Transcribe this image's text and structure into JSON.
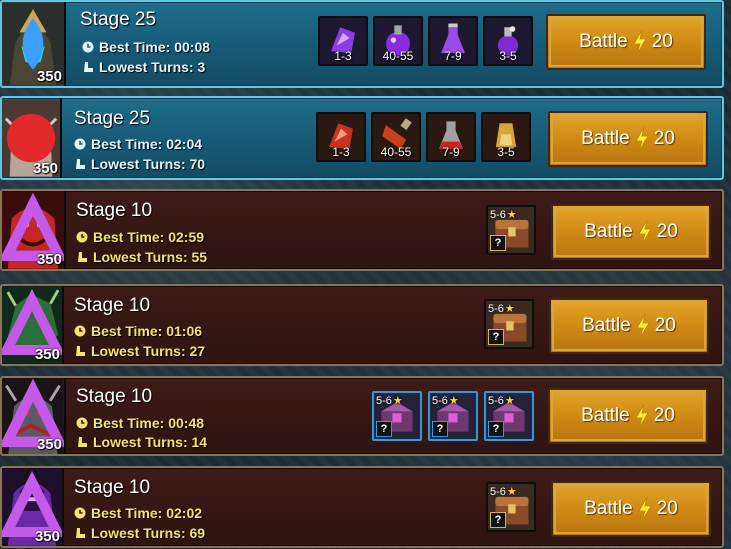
{
  "battle_label": "Battle",
  "energy_cost": "20",
  "rows": [
    {
      "stage": "Stage 25",
      "best_time_label": "Best Time: 00:08",
      "lowest_turns_label": "Lowest Turns: 3",
      "level": "350",
      "rewards": [
        {
          "range": "1-3",
          "icon": "purple-shard-icon"
        },
        {
          "range": "40-55",
          "icon": "purple-potion-icon"
        },
        {
          "range": "7-9",
          "icon": "purple-flask-icon"
        },
        {
          "range": "3-5",
          "icon": "purple-vial-icon"
        }
      ]
    },
    {
      "stage": "Stage 25",
      "best_time_label": "Best Time: 02:04",
      "lowest_turns_label": "Lowest Turns: 70",
      "level": "350",
      "rewards": [
        {
          "range": "1-3",
          "icon": "red-shard-icon"
        },
        {
          "range": "40-55",
          "icon": "red-potion-icon"
        },
        {
          "range": "7-9",
          "icon": "red-flask-icon"
        },
        {
          "range": "3-5",
          "icon": "gold-vial-icon"
        }
      ]
    },
    {
      "stage": "Stage 10",
      "best_time_label": "Best Time: 02:59",
      "lowest_turns_label": "Lowest Turns: 55",
      "level": "350",
      "chests": [
        {
          "stars": "5-6",
          "q": "?"
        }
      ]
    },
    {
      "stage": "Stage 10",
      "best_time_label": "Best Time: 01:06",
      "lowest_turns_label": "Lowest Turns: 27",
      "level": "350",
      "chests": [
        {
          "stars": "5-6",
          "q": "?"
        }
      ]
    },
    {
      "stage": "Stage 10",
      "best_time_label": "Best Time: 00:48",
      "lowest_turns_label": "Lowest Turns: 14",
      "level": "350",
      "chests": [
        {
          "stars": "5-6",
          "q": "?"
        },
        {
          "stars": "5-6",
          "q": "?"
        },
        {
          "stars": "5-6",
          "q": "?"
        }
      ]
    },
    {
      "stage": "Stage 10",
      "best_time_label": "Best Time: 02:02",
      "lowest_turns_label": "Lowest Turns: 69",
      "level": "350",
      "chests": [
        {
          "stars": "5-6",
          "q": "?"
        }
      ]
    }
  ]
}
